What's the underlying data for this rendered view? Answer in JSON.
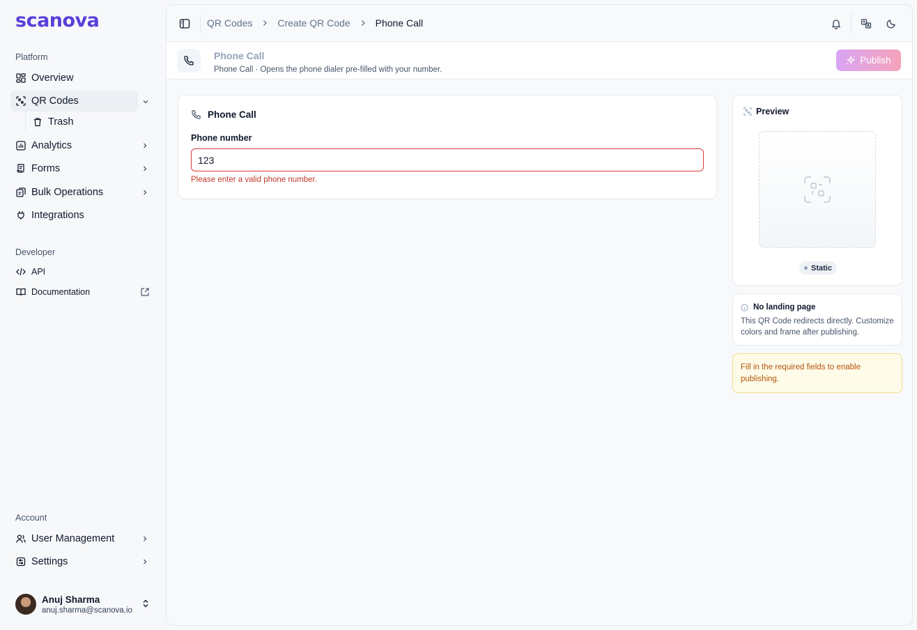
{
  "brand": {
    "logo_text": "scanova"
  },
  "sidebar": {
    "platform_label": "Platform",
    "items": {
      "overview": "Overview",
      "qr_codes": "QR Codes",
      "trash": "Trash",
      "analytics": "Analytics",
      "forms": "Forms",
      "bulk_operations": "Bulk Operations",
      "integrations": "Integrations"
    },
    "developer_label": "Developer",
    "developer_items": {
      "api": "API",
      "documentation": "Documentation"
    },
    "account_label": "Account",
    "account_items": {
      "user_management": "User Management",
      "settings": "Settings"
    },
    "user": {
      "name": "Anuj Sharma",
      "email": "anuj.sharma@scanova.io"
    }
  },
  "breadcrumb": {
    "item1": "QR Codes",
    "item2": "Create QR Code",
    "current": "Phone Call"
  },
  "subheader": {
    "title": "Phone Call",
    "description": "Phone Call · Opens the phone dialer pre-filled with your number.",
    "publish_label": "Publish"
  },
  "form": {
    "card_title": "Phone Call",
    "phone_label": "Phone number",
    "phone_value": "123",
    "phone_error": "Please enter a valid phone number."
  },
  "preview": {
    "title": "Preview",
    "badge": "Static"
  },
  "info": {
    "title": "No landing page",
    "body": "This QR Code redirects directly. Customize colors and frame after publishing."
  },
  "warning": {
    "text": "Fill in the required fields to enable publishing."
  },
  "colors": {
    "brand": "#5b3fd9",
    "error": "#dc3b3b",
    "warning_bg": "#fefbe8",
    "warning_text": "#b45309"
  }
}
